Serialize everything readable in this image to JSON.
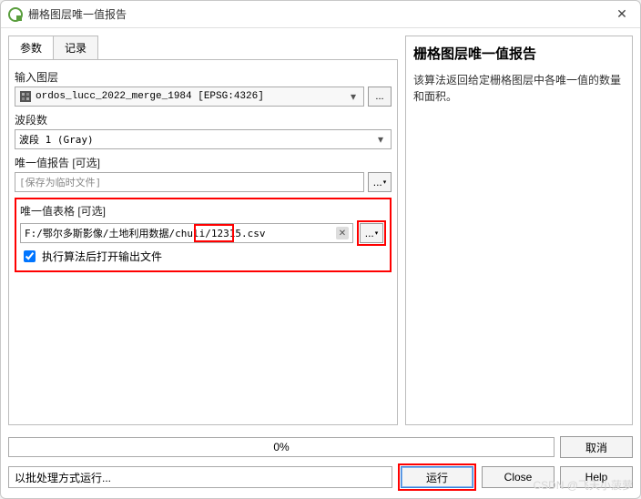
{
  "window": {
    "title": "栅格图层唯一值报告"
  },
  "tabs": {
    "params": "参数",
    "log": "记录"
  },
  "labels": {
    "input_layer": "输入图层",
    "band": "波段数",
    "report": "唯一值报告 [可选]",
    "table": "唯一值表格 [可选]"
  },
  "input_layer": {
    "value": "ordos_lucc_2022_merge_1984 [EPSG:4326]"
  },
  "band": {
    "value": "波段 1 (Gray)"
  },
  "report": {
    "placeholder": "[保存为临时文件]"
  },
  "table": {
    "value": "F:/鄂尔多斯影像/土地利用数据/chuli/12315.csv"
  },
  "open_after": {
    "label": "执行算法后打开输出文件"
  },
  "side": {
    "title": "栅格图层唯一值报告",
    "desc": "该算法返回给定栅格图层中各唯一值的数量和面积。"
  },
  "progress": {
    "text": "0%"
  },
  "buttons": {
    "batch": "以批处理方式运行...",
    "cancel": "取消",
    "run": "运行",
    "close": "Close",
    "help": "Help",
    "browse": "..."
  },
  "watermark": "CSDN @飞天小菠萝"
}
